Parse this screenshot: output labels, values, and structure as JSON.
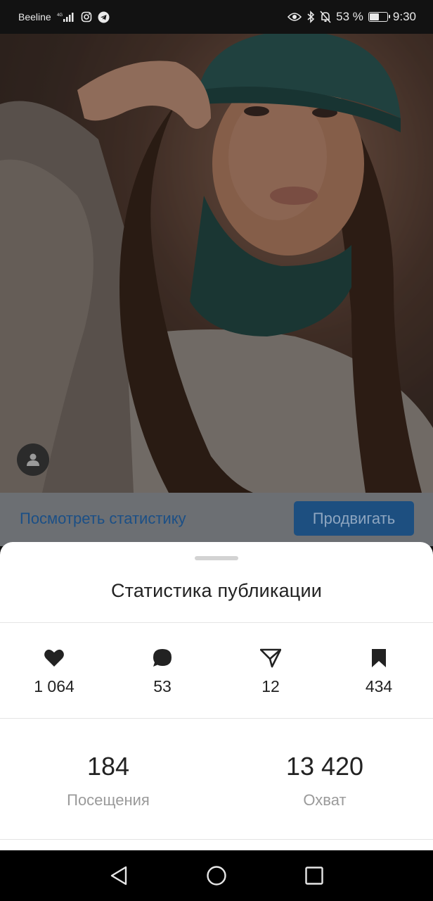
{
  "status_bar": {
    "carrier": "Beeline",
    "battery_percent": "53 %",
    "battery_level": 0.53,
    "time": "9:30",
    "icons": [
      "signal-icon",
      "instagram-icon",
      "telegram-icon",
      "eye-icon",
      "bluetooth-icon",
      "mute-bell-icon",
      "battery-icon"
    ]
  },
  "post": {
    "view_stats_label": "Посмотреть статистику",
    "promote_label": "Продвигать"
  },
  "sheet": {
    "title": "Статистика публикации",
    "metrics": [
      {
        "icon": "heart-icon",
        "value": "1 064"
      },
      {
        "icon": "comment-icon",
        "value": "53"
      },
      {
        "icon": "send-icon",
        "value": "12"
      },
      {
        "icon": "bookmark-icon",
        "value": "434"
      }
    ],
    "kpis": [
      {
        "value": "184",
        "label": "Посещения"
      },
      {
        "value": "13 420",
        "label": "Охват"
      }
    ]
  },
  "nav": {
    "icons": [
      "back-icon",
      "home-icon",
      "recents-icon"
    ]
  },
  "colors": {
    "accent_blue": "#1d4f80",
    "link_blue": "#1b4f86",
    "sheet_bg": "#ffffff",
    "muted_text": "#9a9a9a"
  }
}
